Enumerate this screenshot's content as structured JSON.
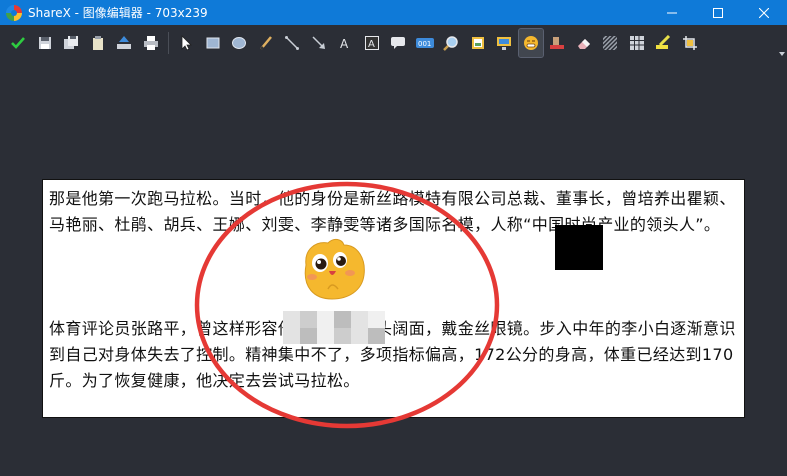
{
  "window": {
    "app_icon": "sharex-logo",
    "title": "ShareX - 图像编辑器 - 703x239",
    "buttons": [
      "minimize-icon",
      "maximize-icon",
      "close-icon"
    ]
  },
  "toolbar": {
    "tools": [
      "checkmark-icon",
      "save-icon",
      "save-as-icon",
      "clipboard-icon",
      "upload-icon",
      "print-icon",
      "separator",
      "select-icon",
      "rectangle-icon",
      "ellipse-icon",
      "freehand-icon",
      "line-icon",
      "arrow-icon",
      "text-icon",
      "text-background-icon",
      "speech-balloon-icon",
      "step-icon",
      "magnify-icon",
      "image-icon",
      "image-screen-icon",
      "sticker-icon",
      "cursor-icon",
      "eraser-icon",
      "blur-icon",
      "pixelate-icon",
      "highlight-icon",
      "crop-icon"
    ],
    "active_tool": "sticker-icon"
  },
  "canvas": {
    "paragraph1": "那是他第一次跑马拉松。当时，他的身份是新丝路模特有限公司总裁、董事长，曾培养出瞿颖、马艳丽、杜鹃、胡兵、王娜、刘雯、李静雯等诸多国际名模，人称“中国时尚产业的领头人”。",
    "paragraph2": "体育评论员张路平，曾这样形容他的样貌：肥头阔面，戴金丝眼镜。步入中年的李小白逐渐意识到自己对身体失去了控制。精神集中不了，多项指标偏高，172公分的身高，体重已经达到170斤。为了恢复健康，他决定去尝试马拉松。",
    "annotations": {
      "circle_color": "#e53935",
      "sticker": "smiling-cat-sticker",
      "redaction": "black-box",
      "pixelate": "pixelated-region"
    }
  }
}
